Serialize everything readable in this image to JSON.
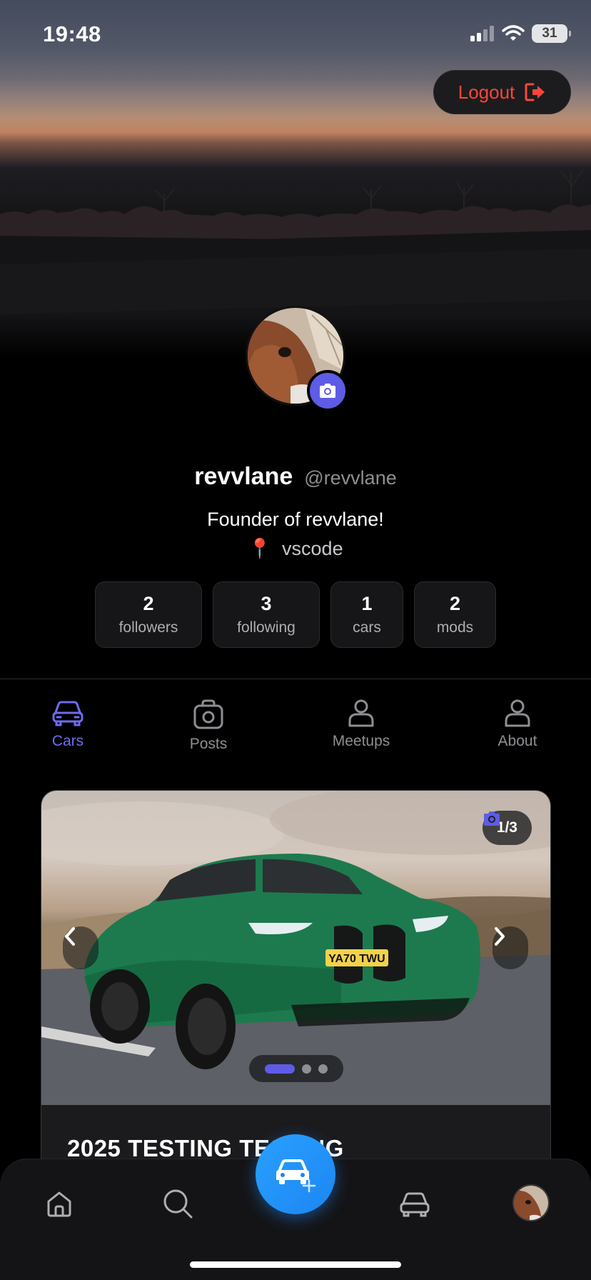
{
  "status_bar": {
    "time": "19:48",
    "battery": "31"
  },
  "header": {
    "logout_label": "Logout"
  },
  "profile": {
    "display_name": "revvlane",
    "handle": "@revvlane",
    "bio": "Founder of revvlane!",
    "location": "vscode",
    "location_icon": "📍"
  },
  "stats": [
    {
      "value": "2",
      "label": "followers"
    },
    {
      "value": "3",
      "label": "following"
    },
    {
      "value": "1",
      "label": "cars"
    },
    {
      "value": "2",
      "label": "mods"
    }
  ],
  "tabs": [
    {
      "label": "Cars",
      "icon": "car-icon",
      "active": true
    },
    {
      "label": "Posts",
      "icon": "camera-bag-icon",
      "active": false
    },
    {
      "label": "Meetups",
      "icon": "person-icon",
      "active": false
    },
    {
      "label": "About",
      "icon": "person-icon",
      "active": false
    }
  ],
  "car_card": {
    "photo_counter": "1/3",
    "photo_count": 3,
    "current_photo": 1,
    "plate": "YA70 TWU",
    "title": "2025 TESTING TESTING"
  },
  "bottom_nav": {
    "items": [
      "home-icon",
      "search-icon",
      "add-car-icon",
      "garage-icon",
      "profile-avatar"
    ]
  },
  "colors": {
    "accent": "#5e5ce6",
    "logout": "#ff453a",
    "fab": "#1c86f2",
    "background": "#000000"
  }
}
